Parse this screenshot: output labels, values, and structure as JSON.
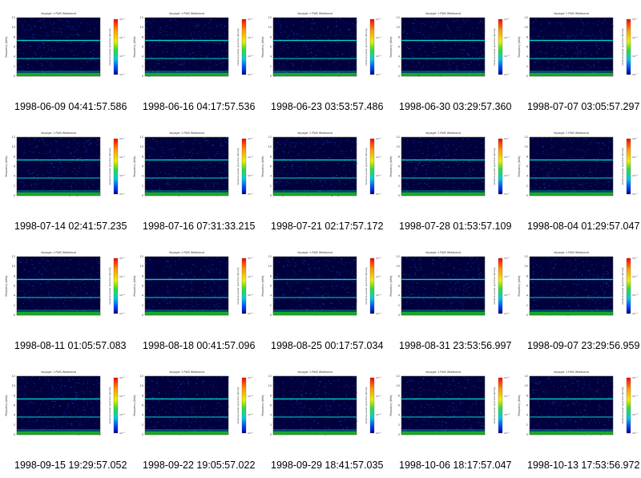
{
  "plots": {
    "plot_title": "Voyager 1 PWS Wideband",
    "axis_label": "Frequency (kHz)",
    "colorbar_label": "relative power spectral density",
    "y_ticks": [
      "12",
      "10",
      "8",
      "6",
      "4",
      "2",
      "0"
    ],
    "colorbar_ticks": [
      "10⁻²",
      "10⁻³",
      "10⁻⁴",
      "10⁻⁵"
    ],
    "colors": {
      "background": "#00003c",
      "speckle": "#2846d2",
      "line": "#00d2c8",
      "noise_floor": "#1ec81e",
      "frame": "#404040"
    }
  },
  "thumbnails": [
    {
      "caption": "1998-06-09 04:41:57.586"
    },
    {
      "caption": "1998-06-16 04:17:57.536"
    },
    {
      "caption": "1998-06-23 03:53:57.486"
    },
    {
      "caption": "1998-06-30 03:29:57.360"
    },
    {
      "caption": "1998-07-07 03:05:57.297"
    },
    {
      "caption": "1998-07-14 02:41:57.235"
    },
    {
      "caption": "1998-07-16 07:31:33.215"
    },
    {
      "caption": "1998-07-21 02:17:57.172"
    },
    {
      "caption": "1998-07-28 01:53:57.109"
    },
    {
      "caption": "1998-08-04 01:29:57.047"
    },
    {
      "caption": "1998-08-11 01:05:57.083"
    },
    {
      "caption": "1998-08-18 00:41:57.096"
    },
    {
      "caption": "1998-08-25 00:17:57.034"
    },
    {
      "caption": "1998-08-31 23:53:56.997"
    },
    {
      "caption": "1998-09-07 23:29:56.959"
    },
    {
      "caption": "1998-09-15 19:29:57.052"
    },
    {
      "caption": "1998-09-22 19:05:57.022"
    },
    {
      "caption": "1998-09-29 18:41:57.035"
    },
    {
      "caption": "1998-10-06 18:17:57.047"
    },
    {
      "caption": "1998-10-13 17:53:56.972"
    }
  ]
}
